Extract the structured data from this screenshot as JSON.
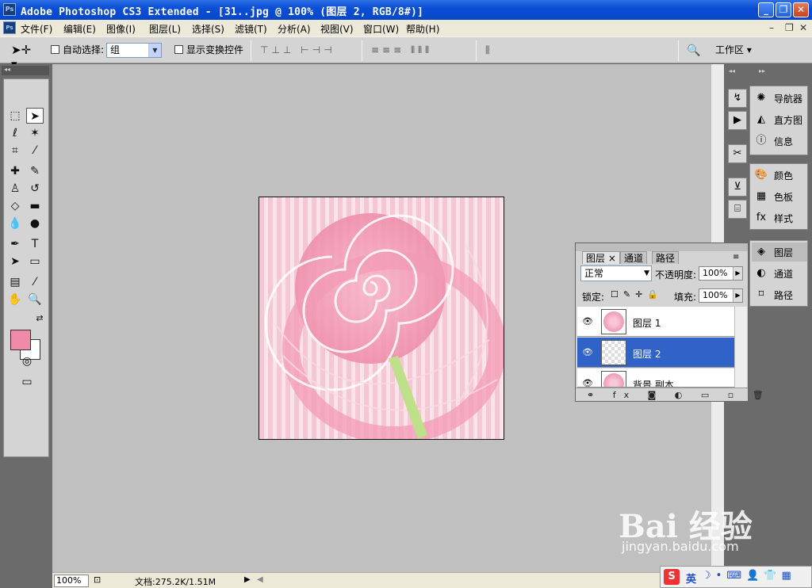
{
  "window": {
    "title": "Adobe Photoshop CS3 Extended - [31..jpg @ 100% (图层 2, RGB/8#)]",
    "app_icon": "Ps"
  },
  "menu": [
    "文件(F)",
    "编辑(E)",
    "图像(I)",
    "图层(L)",
    "选择(S)",
    "滤镜(T)",
    "分析(A)",
    "视图(V)",
    "窗口(W)",
    "帮助(H)"
  ],
  "options": {
    "auto_select_label": "自动选择:",
    "auto_select_value": "组",
    "show_transform_label": "显示变换控件",
    "workspace_label": "工作区 ▾"
  },
  "status": {
    "zoom": "100%",
    "doc_info": "文档:275.2K/1.51M"
  },
  "right_panels": {
    "group1": [
      "导航器",
      "直方图",
      "信息"
    ],
    "group2": [
      "颜色",
      "色板",
      "样式"
    ],
    "group3": [
      "图层",
      "通道",
      "路径"
    ]
  },
  "layers_panel": {
    "tabs": [
      "图层 ×",
      "通道",
      "路径"
    ],
    "blend_mode": "正常",
    "opacity_label": "不透明度:",
    "opacity_value": "100%",
    "lock_label": "锁定:",
    "fill_label": "填充:",
    "fill_value": "100%",
    "layers": [
      {
        "name": "图层 1",
        "selected": false
      },
      {
        "name": "图层 2",
        "selected": true
      },
      {
        "name": "背景 副本",
        "selected": false
      }
    ]
  },
  "colors": {
    "foreground": "#f08aa8",
    "background": "#ffffff"
  },
  "watermark": {
    "text": "Bai 经验",
    "sub": "jingyan.baidu.com"
  },
  "ime": {
    "logo": "S",
    "lang": "英"
  }
}
